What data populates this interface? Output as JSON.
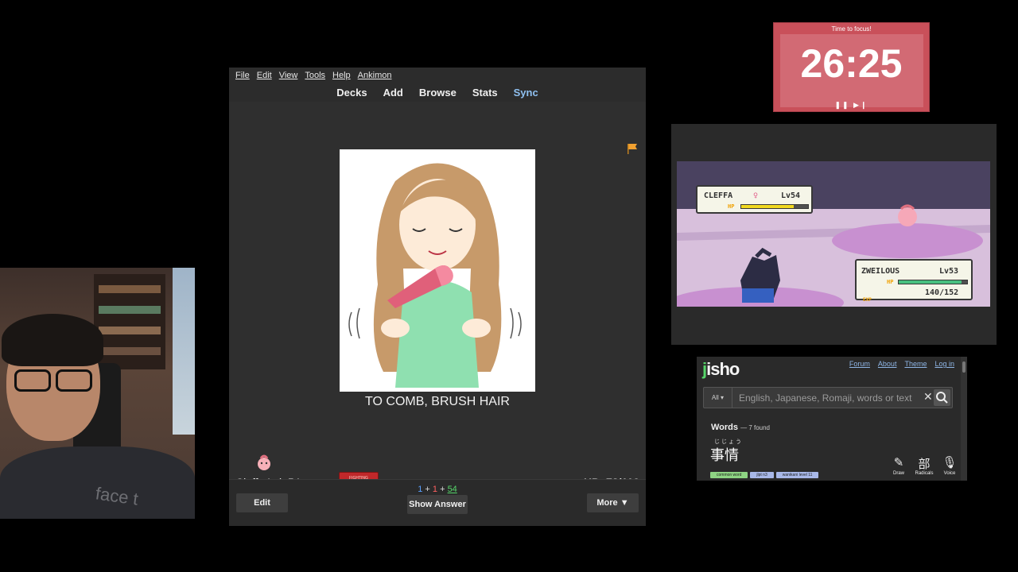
{
  "anki": {
    "menu": [
      "File",
      "Edit",
      "View",
      "Tools",
      "Help",
      "Ankimon"
    ],
    "toolbar": [
      "Decks",
      "Add",
      "Browse",
      "Stats",
      "Sync"
    ],
    "card_text": "TO COMB, BRUSH HAIR",
    "pokemon_name": "Cleffa Lvl: 54",
    "type_badge": "FIGHTING",
    "hp": "HP: 78/119",
    "counts": {
      "new": "1",
      "learning": "1",
      "review": "54",
      "sep": "+"
    },
    "buttons": {
      "edit": "Edit",
      "show_answer": "Show Answer",
      "more": "More ▼"
    },
    "flag_color": "#f0a030"
  },
  "timer": {
    "label": "Time to focus!",
    "time": "26:25",
    "controls": "❚❚ ▶❙",
    "color": "#c9505a"
  },
  "game": {
    "enemy": {
      "name": "CLEFFA",
      "gender": "♀",
      "level": "Lv54",
      "hp_fraction": 0.78,
      "hp_label": "HP"
    },
    "player": {
      "name": "ZWEILOUS",
      "level": "Lv53",
      "hp_text": "140/152",
      "hp_fraction": 0.92,
      "hp_label": "HP",
      "exp_label": "EXP"
    }
  },
  "jisho": {
    "logo_j": "j",
    "logo_rest": "isho",
    "nav": [
      "Forum",
      "About",
      "Theme",
      "Log in"
    ],
    "search": {
      "scope": "All ▾",
      "placeholder": "English, Japanese, Romaji, words or text",
      "clear": "✕"
    },
    "words_label": "Words",
    "words_count": "— 7 found",
    "furigana": "じじょう",
    "kanji": "事情",
    "tags": [
      "common word",
      "jlpt n3",
      "wanikani level 11"
    ],
    "tools": [
      {
        "glyph": "✎",
        "label": "Draw"
      },
      {
        "glyph": "部",
        "label": "Radicals"
      },
      {
        "glyph": "🎙",
        "label": "Voice"
      }
    ]
  },
  "webcam": {
    "shirt_text": "face t"
  }
}
